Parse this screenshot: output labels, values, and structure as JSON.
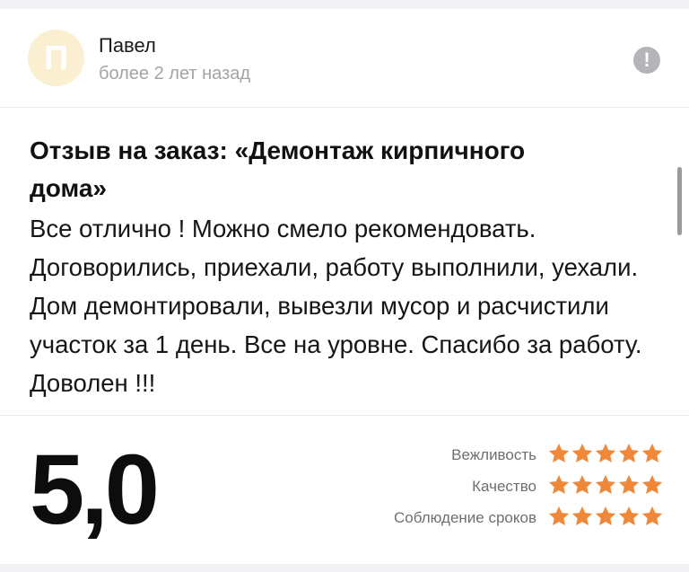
{
  "review": {
    "avatar_letter": "П",
    "author_name": "Павел",
    "date": "более 2 лет назад",
    "report_icon": "exclamation-circle-icon",
    "title": "Отзыв на заказ: «Демонтаж кирпичного дома»",
    "text": "Все отлично ! Можно смело рекомендовать. Договорились, приехали, работу выполнили, уехали. Дом демонтировали, вывезли мусор и расчистили участок за 1 день. Все на уровне. Спасибо за работу. Доволен !!!"
  },
  "rating": {
    "overall": "5,0",
    "criteria": [
      {
        "label": "Вежливость",
        "stars": 5
      },
      {
        "label": "Качество",
        "stars": 5
      },
      {
        "label": "Соблюдение сроков",
        "stars": 5
      }
    ],
    "star_color": "#f0883a",
    "star_icon": "star-icon"
  },
  "colors": {
    "avatar_bg": "#fbefd2",
    "muted_text": "#a3a3a8",
    "icon_gray": "#b5b5b9"
  }
}
